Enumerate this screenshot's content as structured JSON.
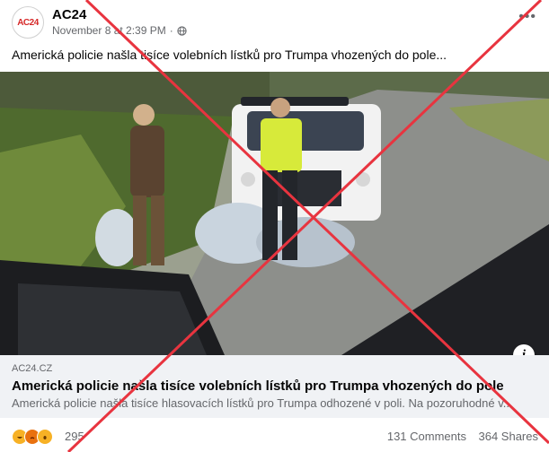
{
  "post": {
    "page_name": "AC24",
    "avatar_text": "AC24",
    "date": "November 8 at 2:39 PM",
    "separator": "·",
    "more_label": "•••",
    "text": "Americká policie našla tisíce volebních lístků pro Trumpa vhozených do pole..."
  },
  "photo": {
    "info_label": "i"
  },
  "link": {
    "domain": "AC24.CZ",
    "title": "Americká policie našla tisíce volebních lístků pro Trumpa vhozených do pole",
    "description": "Americká policie našla tisíce hlasovacích lístků pro Trumpa odhozené v poli. Na pozoruhodné v..."
  },
  "footer": {
    "reaction_count": "295",
    "reactions": [
      "haha",
      "angry",
      "wow"
    ],
    "comments": "131 Comments",
    "shares": "364 Shares"
  },
  "overlay": {
    "color": "#e8343f"
  }
}
